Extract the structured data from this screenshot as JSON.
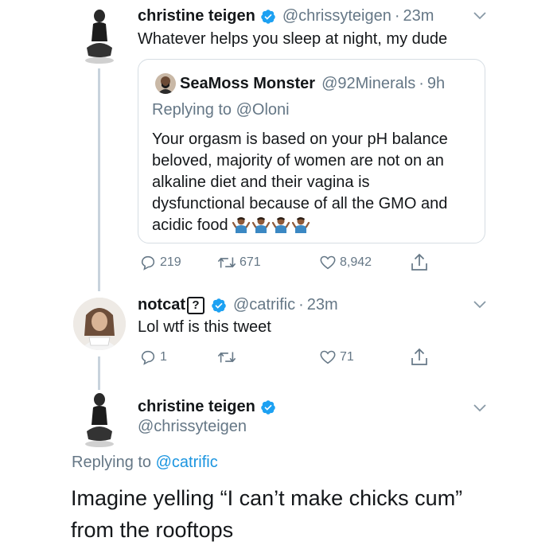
{
  "tweet1": {
    "name": "christine teigen",
    "handle": "@chrissyteigen",
    "time": "23m",
    "text": "Whatever helps you sleep at night, my dude",
    "quote": {
      "name": "SeaMoss Monster",
      "handle": "@92Minerals",
      "time": "9h",
      "replying_prefix": "Replying to ",
      "replying_to": "@Oloni",
      "lines": [
        "Your orgasm is based on your pH balance",
        "beloved, majority of women are not on an",
        "alkaline diet and their vagina is",
        "dysfunctional because of all the GMO and",
        "acidic food"
      ],
      "emoji_icon": "person-shrugging-emoji"
    },
    "stats": {
      "replies": "219",
      "retweets": "671",
      "likes": "8,942"
    }
  },
  "tweet2": {
    "name": "notcat",
    "name_badge": "?",
    "handle": "@catrific",
    "time": "23m",
    "text": "Lol wtf is this tweet",
    "stats": {
      "replies": "1",
      "retweets": "",
      "likes": "71"
    }
  },
  "tweet3": {
    "name": "christine teigen",
    "handle": "@chrissyteigen",
    "replying_prefix": "Replying to ",
    "replying_to": "@catrific",
    "text_lines": [
      "Imagine yelling “I can’t make chicks cum”",
      "from the rooftops"
    ]
  },
  "colors": {
    "verified": "#1da1f2",
    "link": "#1b95e0",
    "muted": "#657786",
    "thread_line": "#c8d3dd"
  }
}
